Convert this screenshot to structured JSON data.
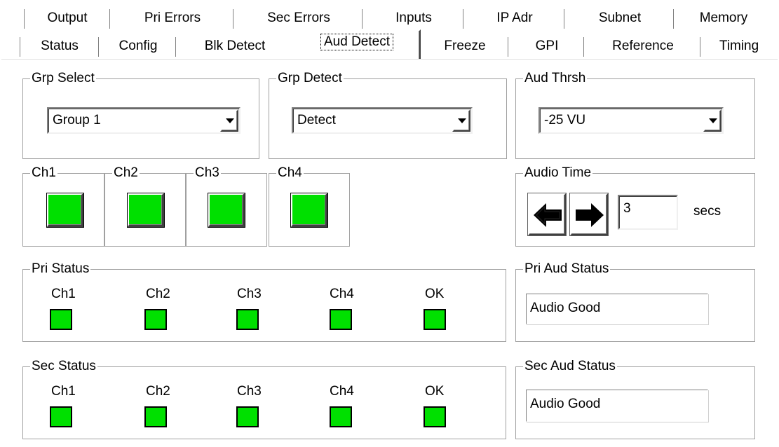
{
  "tabs_top": [
    "Output",
    "Pri Errors",
    "Sec Errors",
    "Inputs",
    "IP Adr",
    "Subnet",
    "Memory"
  ],
  "tabs_bottom": [
    "Status",
    "Config",
    "Blk Detect",
    "Aud Detect",
    "Freeze",
    "GPI",
    "Reference",
    "Timing"
  ],
  "active_tab": "Aud Detect",
  "grp_select": {
    "label": "Grp Select",
    "value": "Group 1"
  },
  "grp_detect": {
    "label": "Grp Detect",
    "value": "Detect"
  },
  "aud_thrsh": {
    "label": "Aud Thrsh",
    "value": "-25 VU"
  },
  "channels": [
    "Ch1",
    "Ch2",
    "Ch3",
    "Ch4"
  ],
  "audio_time": {
    "label": "Audio Time",
    "value": "3",
    "unit": "secs",
    "left_icon": "arrow-left-icon",
    "right_icon": "arrow-right-icon"
  },
  "pri_status": {
    "label": "Pri Status",
    "items": [
      "Ch1",
      "Ch2",
      "Ch3",
      "Ch4",
      "OK"
    ]
  },
  "sec_status": {
    "label": "Sec Status",
    "items": [
      "Ch1",
      "Ch2",
      "Ch3",
      "Ch4",
      "OK"
    ]
  },
  "pri_aud_status": {
    "label": "Pri Aud Status",
    "value": "Audio Good"
  },
  "sec_aud_status": {
    "label": "Sec Aud Status",
    "value": "Audio Good"
  },
  "colors": {
    "indicator_green": "#00e000"
  }
}
